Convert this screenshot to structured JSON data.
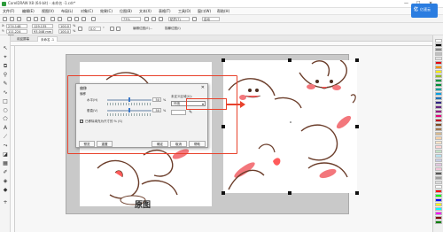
{
  "window": {
    "title": "CorelDRAW X8 (64-bit) - 未命名 -1.cdr*",
    "controls": [
      "—",
      "☐",
      "✕"
    ]
  },
  "menu": [
    "文件(F)",
    "编辑(E)",
    "视图(V)",
    "布局(L)",
    "对象(C)",
    "效果(C)",
    "位图(B)",
    "文本(X)",
    "表格(T)",
    "工具(O)",
    "窗口(W)",
    "帮助(H)"
  ],
  "badge": {
    "logo": "亿",
    "text": "亿速云"
  },
  "toolbar": {
    "zoom": "73%",
    "snap": "贴齐(T)",
    "launch": "启动"
  },
  "propbar": {
    "x": "274.148 mm",
    "y": "111.224 mm",
    "w": "129.135 mm",
    "h": "93.048 mm",
    "sx": "100.0",
    "sy": "100.0",
    "pct": "%",
    "angle": "0.0",
    "deg": "°",
    "edit_bitmap": "编辑位图(E)...",
    "trace": "描摹位图(I)"
  },
  "tabs": [
    "欢迎屏幕",
    "未命名 -1"
  ],
  "caption": "原图",
  "dialog": {
    "title": "偏移",
    "close": "✕",
    "group": "偏移",
    "horizontal_label": "水平(H)",
    "horizontal_value": "50",
    "vertical_label": "垂直(V)",
    "vertical_value": "50",
    "unit": "%",
    "percent_check_label": "已移除填充为尺寸的 % (S)",
    "undefined_area_label": "未定义区域(U):",
    "undefined_area_value": "环绕",
    "buttons": {
      "preview": "预览",
      "reset": "重置",
      "ok": "确定",
      "cancel": "取消",
      "help": "帮助"
    }
  },
  "palette_colors": [
    "#ffffff",
    "#000000",
    "#8a8a8a",
    "#c0c0c0",
    "#e0e0e0",
    "#e30613",
    "#f39200",
    "#ffed00",
    "#95c11f",
    "#009640",
    "#008d36",
    "#00a19a",
    "#009fe3",
    "#1d71b8",
    "#312783",
    "#662483",
    "#951b81",
    "#e6007e",
    "#be1622",
    "#7c4b24",
    "#a5774f",
    "#d7b98e",
    "#f7d1a6",
    "#fde5c8",
    "#ffd5d5",
    "#c1e1c5",
    "#b7e4f1",
    "#c7cbe6",
    "#e1c6e0",
    "#f4c5d9",
    "#575756",
    "#9d9d9c",
    "#dadada",
    "#ffffff",
    "#ff0000",
    "#00ff00",
    "#0000ff",
    "#ffff00",
    "#00ffff",
    "#ff00ff",
    "#800000",
    "#008000"
  ],
  "accent": "#e8412b"
}
